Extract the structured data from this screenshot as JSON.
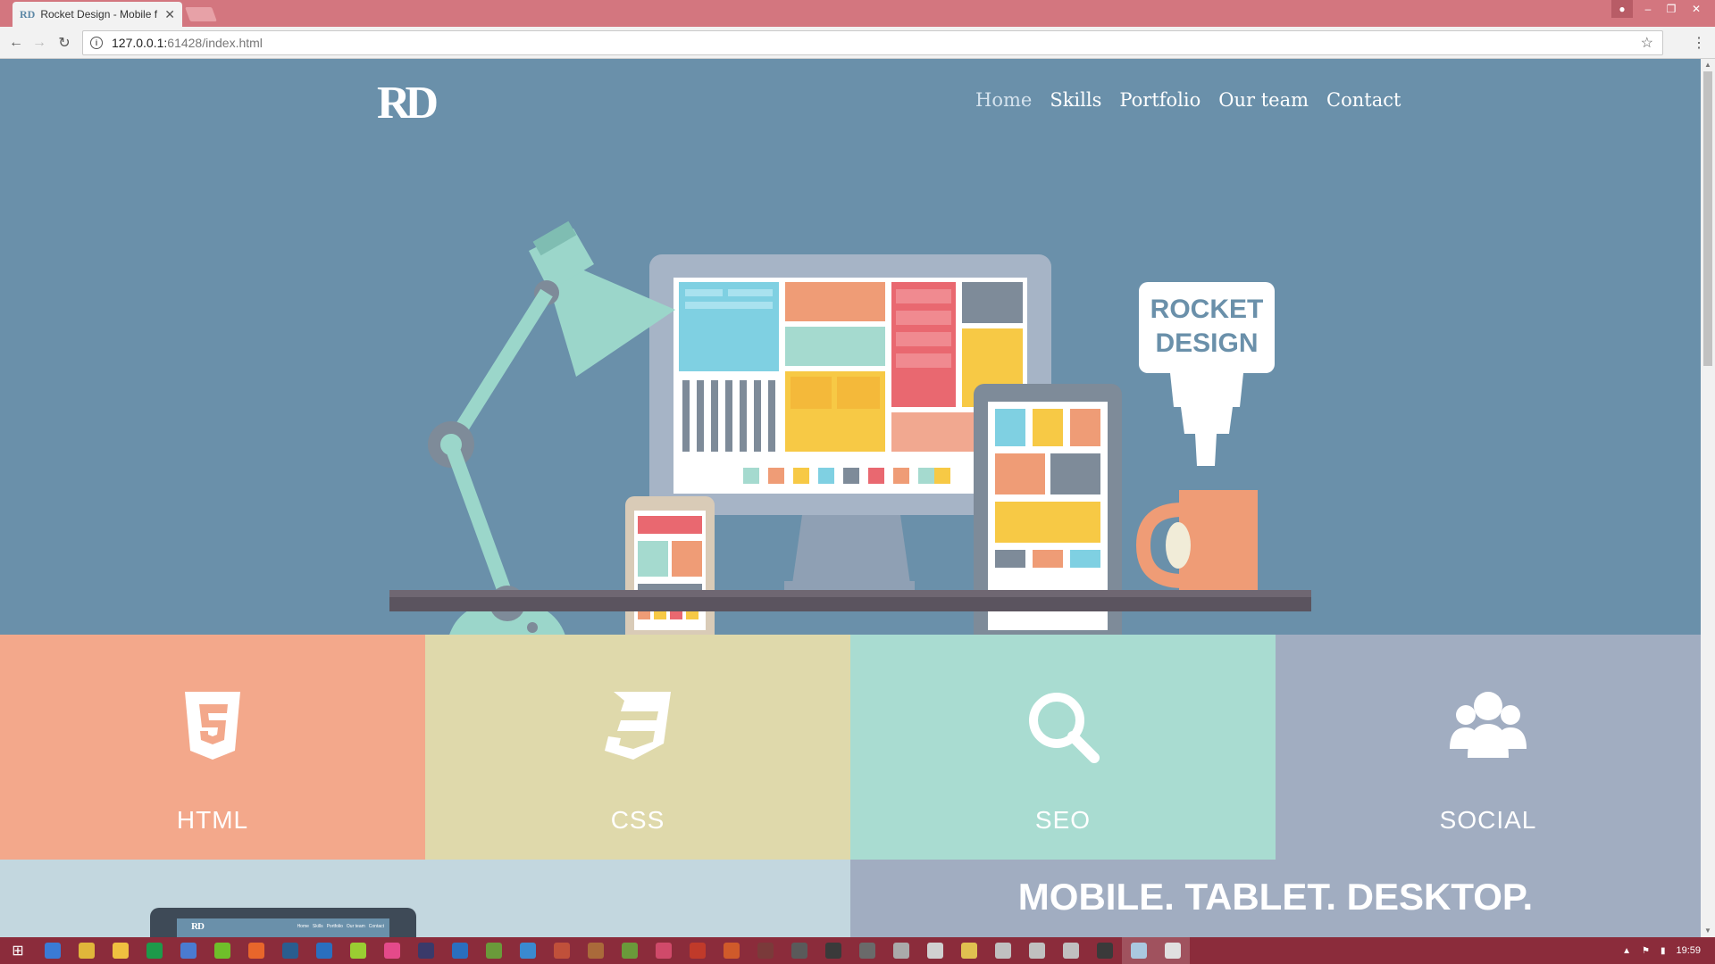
{
  "browser": {
    "tab_title": "Rocket Design - Mobile f",
    "tab_favicon": "RD",
    "tab_close": "✕",
    "url_host": "127.0.0.1:",
    "url_path": "61428/index.html",
    "info_icon": "i",
    "back_icon": "←",
    "forward_icon": "→",
    "reload_icon": "↻",
    "star_icon": "☆",
    "menu_icon": "⋮",
    "min_icon": "–",
    "max_icon": "❐",
    "close_icon": "✕",
    "user_icon": "●"
  },
  "site": {
    "logo": "RD",
    "nav": [
      {
        "label": "Home",
        "active": true
      },
      {
        "label": "Skills",
        "active": false
      },
      {
        "label": "Portfolio",
        "active": false
      },
      {
        "label": "Our team",
        "active": false
      },
      {
        "label": "Contact",
        "active": false
      }
    ],
    "sign_line1": "ROCKET",
    "sign_line2": "DESIGN",
    "features": [
      {
        "label": "HTML",
        "icon": "html5-icon",
        "color": "#f3a88b"
      },
      {
        "label": "CSS",
        "icon": "css3-icon",
        "color": "#dfd9ab"
      },
      {
        "label": "SEO",
        "icon": "search-icon",
        "color": "#a9dcd1"
      },
      {
        "label": "SOCIAL",
        "icon": "users-icon",
        "color": "#a1adc1"
      }
    ],
    "lower_title": "MOBILE. TABLET. DESKTOP.",
    "mini_logo": "RD",
    "mini_nav": [
      "Home",
      "Skills",
      "Portfolio",
      "Our team",
      "Contact"
    ]
  },
  "colors": {
    "titlebar": "#d3767f",
    "hero_bg": "#6a90aa",
    "taskbar": "#8b2c3b"
  },
  "taskbar": {
    "start_icon": "⊞",
    "clock": "19:59",
    "apps": [
      "ie",
      "chrome",
      "folder",
      "app-green",
      "app-blue",
      "app-utorrent",
      "app-orange",
      "steam",
      "app-outlook",
      "app-lime",
      "app-pink",
      "app-obs",
      "photoshop",
      "dreamweaver",
      "app-blue2",
      "app-game1",
      "app-game2",
      "app-game3",
      "app-game4",
      "app-game5",
      "app-game6",
      "app-game7",
      "app-game8",
      "app-game9",
      "app-game10",
      "app-game11",
      "app-game12",
      "app-game13",
      "app-game14",
      "app-game15",
      "app-game16",
      "app-game17",
      "app-explorer",
      "chrome-active"
    ]
  }
}
